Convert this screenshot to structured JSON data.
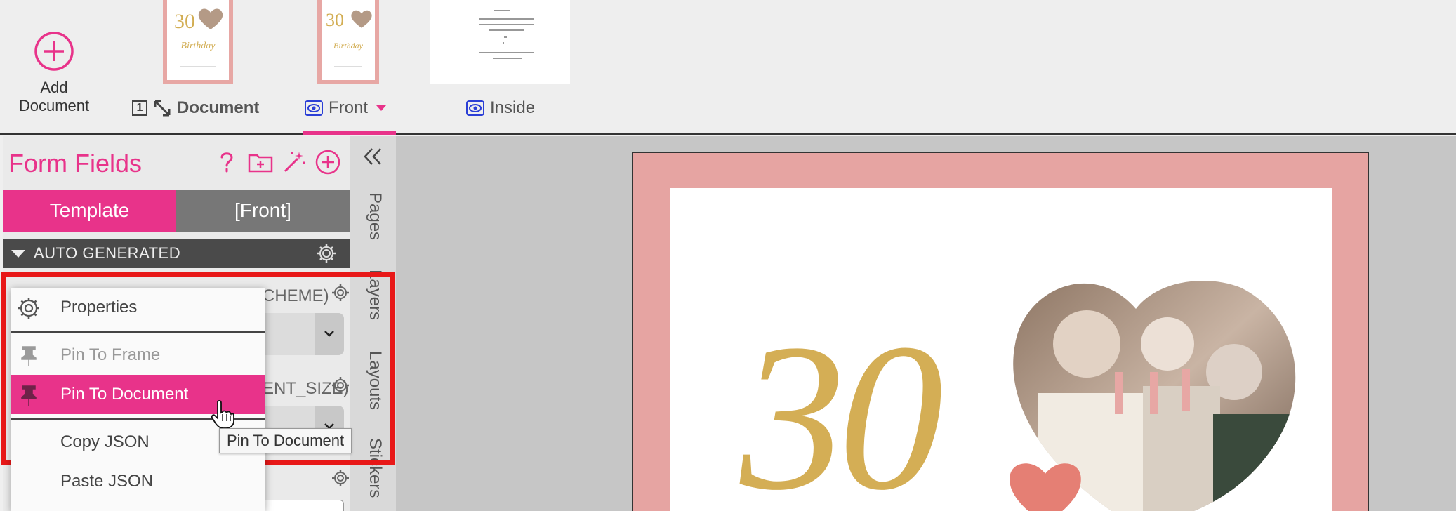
{
  "toolbar": {
    "add_document_label": "Add\nDocument",
    "document_tab": {
      "number": "1",
      "label": "Document"
    },
    "front_tab": {
      "label": "Front"
    },
    "inside_tab": {
      "label": "Inside"
    }
  },
  "thumbnails": {
    "front_number": "30",
    "front_word": "Birthday"
  },
  "left_panel": {
    "title": "Form Fields",
    "segments": [
      "Template",
      "[Front]"
    ],
    "group_header": "AUTO GENERATED",
    "field1_label_fragment": "CHEME)",
    "field2_label_fragment": "ENT_SIZE)"
  },
  "side_tabs": [
    "Pages",
    "Layers",
    "Layouts",
    "Stickers"
  ],
  "context_menu": {
    "items": [
      {
        "label": "Properties",
        "icon": "gear-icon",
        "state": "normal"
      },
      {
        "label": "Pin To Frame",
        "icon": "pin-icon",
        "state": "disabled"
      },
      {
        "label": "Pin To Document",
        "icon": "pin-icon",
        "state": "active"
      },
      {
        "label": "Copy JSON",
        "icon": "",
        "state": "normal"
      },
      {
        "label": "Paste JSON",
        "icon": "",
        "state": "normal"
      }
    ]
  },
  "tooltip": "Pin To Document",
  "canvas": {
    "number": "30"
  },
  "colors": {
    "accent": "#e8338a",
    "highlight": "#e81818",
    "card_pink": "#e6a4a2",
    "gold": "#d4ae55"
  }
}
